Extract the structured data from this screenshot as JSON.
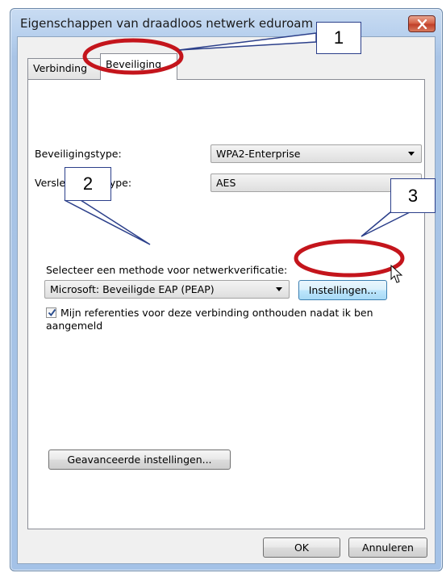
{
  "window": {
    "title": "Eigenschappen van draadloos netwerk eduroam"
  },
  "tabs": [
    {
      "label": "Verbinding",
      "selected": false
    },
    {
      "label": "Beveiliging",
      "selected": true
    }
  ],
  "security": {
    "type_label": "Beveiligingstype:",
    "type_value": "WPA2-Enterprise",
    "encryption_label": "Versleutelingstype:",
    "encryption_value": "AES",
    "method_label": "Selecteer een methode voor netwerkverificatie:",
    "method_value": "Microsoft: Beveiligde EAP (PEAP)",
    "settings_button": "Instellingen...",
    "remember_checkbox": {
      "checked": true,
      "label_line1": "Mijn referenties voor deze verbinding onthouden nadat ik ben",
      "label_line2": "aangemeld"
    },
    "advanced_button": "Geavanceerde instellingen..."
  },
  "footer": {
    "ok_button": "OK",
    "cancel_button": "Annuleren"
  },
  "annotations": {
    "callout_1": "1",
    "callout_2": "2",
    "callout_3": "3",
    "highlight_color": "#c4151c",
    "callout_border_color": "#2b3f8a"
  },
  "icons": {
    "close": "close-icon",
    "dropdown": "chevron-down-icon",
    "checkmark": "checkmark-icon",
    "cursor": "mouse-pointer-icon"
  }
}
